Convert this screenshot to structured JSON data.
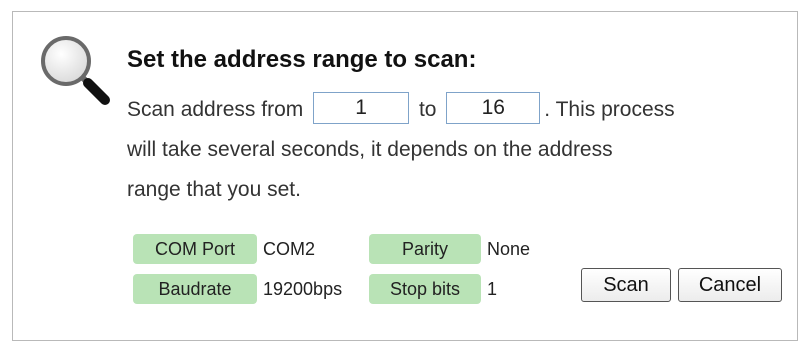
{
  "dialog": {
    "title": "Set the address range to scan:",
    "desc_part1": "Scan address from",
    "from_value": "1",
    "to_label": "to",
    "to_value": "16",
    "desc_part2": ". This process",
    "desc_line2": "will take several seconds, it depends on the address",
    "desc_line3": "range that you set.",
    "icon": "search-icon"
  },
  "settings": {
    "com_port_label": "COM Port",
    "com_port_value": "COM2",
    "parity_label": "Parity",
    "parity_value": "None",
    "baudrate_label": "Baudrate",
    "baudrate_value": "19200bps",
    "stop_bits_label": "Stop bits",
    "stop_bits_value": "1",
    "tag_color": "#b9e3b6"
  },
  "buttons": {
    "scan_label": "Scan",
    "cancel_label": "Cancel"
  }
}
